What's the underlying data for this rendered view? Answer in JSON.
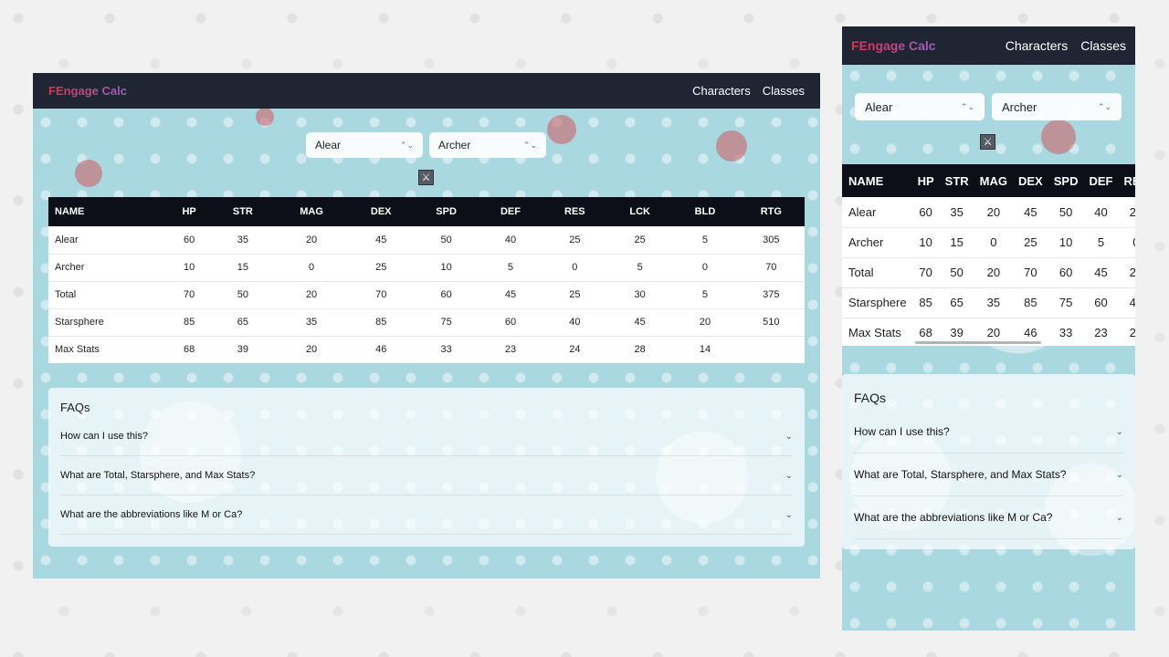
{
  "brand": "FEngage Calc",
  "nav": {
    "characters": "Characters",
    "classes": "Classes"
  },
  "selects": {
    "character": "Alear",
    "class": "Archer"
  },
  "icons": {
    "select_chevron": "chevron-updown-icon",
    "swap": "crossed-swords-icon",
    "faq_chevron": "chevron-down-icon"
  },
  "colors": {
    "navbar": "#1f2533",
    "table_header": "#0c0f17",
    "brand_start": "#d8344f",
    "brand_end": "#9a63c2",
    "background": "#a9d8e1"
  },
  "table": {
    "headers": [
      "NAME",
      "HP",
      "STR",
      "MAG",
      "DEX",
      "SPD",
      "DEF",
      "RES",
      "LCK",
      "BLD",
      "RTG"
    ],
    "rows": [
      [
        "Alear",
        "60",
        "35",
        "20",
        "45",
        "50",
        "40",
        "25",
        "25",
        "5",
        "305"
      ],
      [
        "Archer",
        "10",
        "15",
        "0",
        "25",
        "10",
        "5",
        "0",
        "5",
        "0",
        "70"
      ],
      [
        "Total",
        "70",
        "50",
        "20",
        "70",
        "60",
        "45",
        "25",
        "30",
        "5",
        "375"
      ],
      [
        "Starsphere",
        "85",
        "65",
        "35",
        "85",
        "75",
        "60",
        "40",
        "45",
        "20",
        "510"
      ],
      [
        "Max Stats",
        "68",
        "39",
        "20",
        "46",
        "33",
        "23",
        "24",
        "28",
        "14",
        ""
      ]
    ]
  },
  "faq": {
    "title": "FAQs",
    "items": [
      {
        "question": "How can I use this?"
      },
      {
        "question": "What are Total, Starsphere, and Max Stats?"
      },
      {
        "question": "What are the abbreviations like M or Ca?"
      }
    ]
  }
}
